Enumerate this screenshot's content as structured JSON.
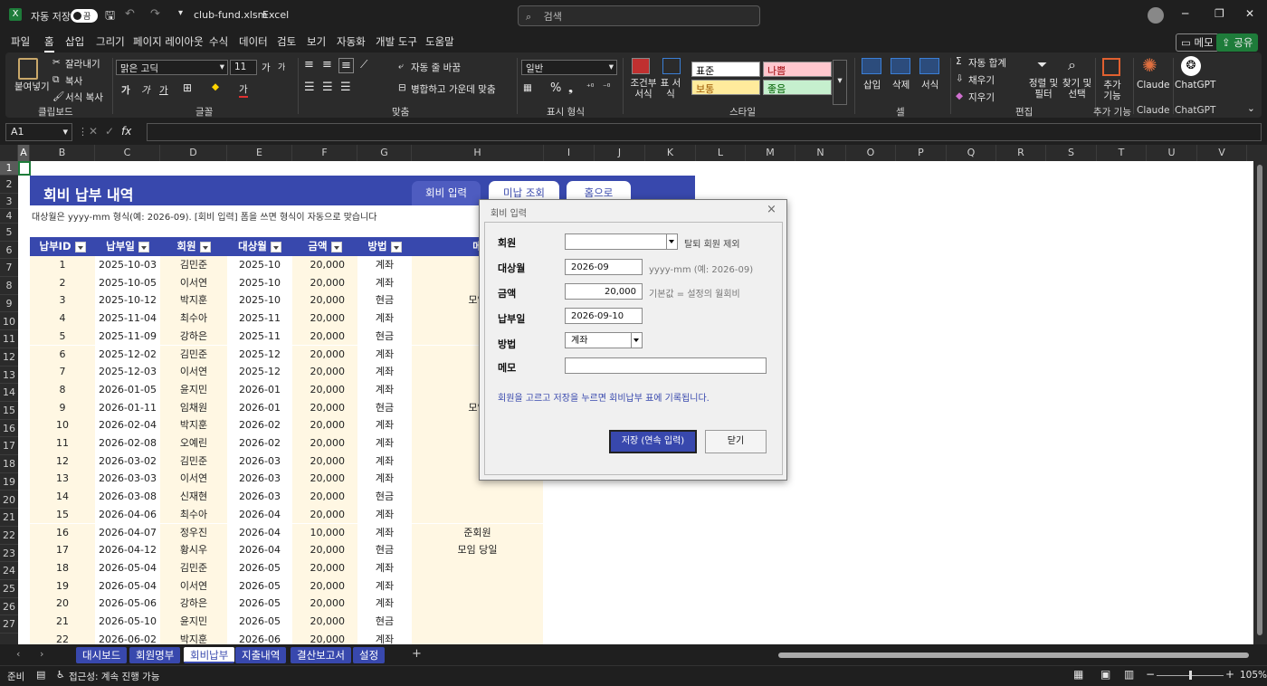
{
  "titlebar": {
    "autosave_label": "자동 저장",
    "autosave_state": "끔",
    "filename": "club-fund.xlsm",
    "app": "Excel",
    "search_placeholder": "검색",
    "win_min": "─",
    "win_max": "❐",
    "win_close": "✕"
  },
  "menu": {
    "items": [
      "파일",
      "홈",
      "삽입",
      "그리기",
      "페이지 레이아웃",
      "수식",
      "데이터",
      "검토",
      "보기",
      "자동화",
      "개발 도구",
      "도움말"
    ],
    "active": "홈",
    "memo": "메모",
    "share": "공유"
  },
  "ribbon": {
    "clipboard": {
      "paste": "붙여넣기",
      "cut": "잘라내기",
      "copy": "복사",
      "format_painter": "서식 복사",
      "label": "클립보드"
    },
    "font": {
      "name": "맑은 고딕",
      "size": "11",
      "grow": "가",
      "shrink": "가",
      "bold": "가",
      "italic": "가",
      "underline": "가",
      "label": "글꼴"
    },
    "alignment": {
      "wrap": "자동 줄 바꿈",
      "merge": "병합하고 가운데 맞춤",
      "label": "맞춤"
    },
    "number": {
      "format": "일반",
      "label": "표시 형식"
    },
    "styles": {
      "conditional": "조건부 서식",
      "table": "표 서식",
      "normal": "표준",
      "bad": "나쁨",
      "neutral": "보통",
      "good": "좋음",
      "label": "스타일"
    },
    "cells": {
      "insert": "삽입",
      "delete": "삭제",
      "format": "서식",
      "label": "셀"
    },
    "editing": {
      "autosum": "자동 합계",
      "fill": "채우기",
      "clear": "지우기",
      "sort": "정렬 및 필터",
      "find": "찾기 및 선택",
      "label": "편집"
    },
    "addins": {
      "label": "추가 기능",
      "btn": "추가 기능"
    },
    "claude": {
      "label": "Claude",
      "btn": "Claude"
    },
    "chatgpt": {
      "label": "ChatGPT",
      "btn": "ChatGPT"
    }
  },
  "formula": {
    "namebox": "A1",
    "fx": "fx"
  },
  "columns": [
    "A",
    "B",
    "C",
    "D",
    "E",
    "F",
    "G",
    "H",
    "I",
    "J",
    "K",
    "L",
    "M",
    "N",
    "O",
    "P",
    "Q",
    "R",
    "S",
    "T",
    "U",
    "V"
  ],
  "rows": [
    "1",
    "2",
    "3",
    "4",
    "5",
    "6",
    "7",
    "8",
    "9",
    "10",
    "11",
    "12",
    "13",
    "14",
    "15",
    "16",
    "17",
    "18",
    "19",
    "20",
    "21",
    "22",
    "23",
    "24",
    "25",
    "26",
    "27"
  ],
  "sheet": {
    "title": "회비 납부 내역",
    "nav": [
      "회비 입력",
      "미납 조회",
      "홈으로"
    ],
    "note": "대상월은 yyyy-mm 형식(예: 2026-09). [회비 입력] 폼을 쓰면 형식이 자동으로 맞습니다",
    "headers": [
      "납부ID",
      "납부일",
      "회원",
      "대상월",
      "금액",
      "방법",
      "메"
    ],
    "data": [
      [
        "1",
        "2025-10-03",
        "김민준",
        "2025-10",
        "20,000",
        "계좌",
        ""
      ],
      [
        "2",
        "2025-10-05",
        "이서연",
        "2025-10",
        "20,000",
        "계좌",
        ""
      ],
      [
        "3",
        "2025-10-12",
        "박지훈",
        "2025-10",
        "20,000",
        "현금",
        "모임"
      ],
      [
        "4",
        "2025-11-04",
        "최수아",
        "2025-11",
        "20,000",
        "계좌",
        ""
      ],
      [
        "5",
        "2025-11-09",
        "강하은",
        "2025-11",
        "20,000",
        "현금",
        ""
      ],
      [
        "6",
        "2025-12-02",
        "김민준",
        "2025-12",
        "20,000",
        "계좌",
        ""
      ],
      [
        "7",
        "2025-12-03",
        "이서연",
        "2025-12",
        "20,000",
        "계좌",
        ""
      ],
      [
        "8",
        "2026-01-05",
        "윤지민",
        "2026-01",
        "20,000",
        "계좌",
        ""
      ],
      [
        "9",
        "2026-01-11",
        "임채원",
        "2026-01",
        "20,000",
        "현금",
        "모임"
      ],
      [
        "10",
        "2026-02-04",
        "박지훈",
        "2026-02",
        "20,000",
        "계좌",
        ""
      ],
      [
        "11",
        "2026-02-08",
        "오예린",
        "2026-02",
        "20,000",
        "계좌",
        ""
      ],
      [
        "12",
        "2026-03-02",
        "김민준",
        "2026-03",
        "20,000",
        "계좌",
        ""
      ],
      [
        "13",
        "2026-03-03",
        "이서연",
        "2026-03",
        "20,000",
        "계좌",
        ""
      ],
      [
        "14",
        "2026-03-08",
        "신재현",
        "2026-03",
        "20,000",
        "현금",
        ""
      ],
      [
        "15",
        "2026-04-06",
        "최수아",
        "2026-04",
        "20,000",
        "계좌",
        ""
      ],
      [
        "16",
        "2026-04-07",
        "정우진",
        "2026-04",
        "10,000",
        "계좌",
        "준회원"
      ],
      [
        "17",
        "2026-04-12",
        "황시우",
        "2026-04",
        "20,000",
        "현금",
        "모임 당일"
      ],
      [
        "18",
        "2026-05-04",
        "김민준",
        "2026-05",
        "20,000",
        "계좌",
        ""
      ],
      [
        "19",
        "2026-05-04",
        "이서연",
        "2026-05",
        "20,000",
        "계좌",
        ""
      ],
      [
        "20",
        "2026-05-06",
        "강하은",
        "2026-05",
        "20,000",
        "계좌",
        ""
      ],
      [
        "21",
        "2026-05-10",
        "윤지민",
        "2026-05",
        "20,000",
        "현금",
        ""
      ],
      [
        "22",
        "2026-06-02",
        "박지훈",
        "2026-06",
        "20,000",
        "계좌",
        ""
      ]
    ]
  },
  "dialog": {
    "title": "회비 입력",
    "close": "×",
    "member_label": "회원",
    "member_value": "",
    "member_hint": "탈퇴 회원 제외",
    "month_label": "대상월",
    "month_value": "2026-09",
    "month_hint": "yyyy-mm (예: 2026-09)",
    "amount_label": "금액",
    "amount_value": "20,000",
    "amount_hint": "기본값 = 설정의 월회비",
    "date_label": "납부일",
    "date_value": "2026-09-10",
    "method_label": "방법",
    "method_value": "계좌",
    "memo_label": "메모",
    "memo_value": "",
    "info": "회원을 고르고 저장을 누르면 회비납부 표에 기록됩니다.",
    "save": "저장 (연속 입력)",
    "cancel": "닫기"
  },
  "tabs": {
    "items": [
      "대시보드",
      "회원명부",
      "회비납부",
      "지출내역",
      "결산보고서",
      "설정"
    ],
    "selected": "회비납부",
    "add": "+"
  },
  "status": {
    "ready": "준비",
    "accessibility": "접근성: 계속 진행 가능",
    "zoom": "105%"
  },
  "colors": {
    "accent": "#3848ad",
    "band": "#fff7e3",
    "share": "#1e7c3a"
  }
}
